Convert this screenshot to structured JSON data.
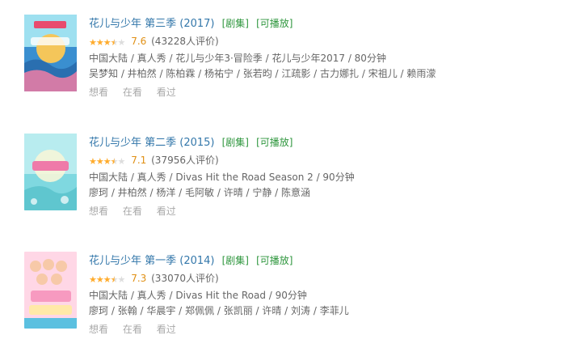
{
  "items": [
    {
      "title": "花儿与少年 第三季 (2017)",
      "tag_series": "[剧集]",
      "tag_play": "[可播放]",
      "rating": 3.8,
      "score": "7.6",
      "votes": "(43228人评价)",
      "meta_line1": "中国大陆 / 真人秀 / 花儿与少年3·冒险季 / 花儿与少年2017 / 80分钟",
      "meta_line2": "吴梦知 / 井柏然 / 陈柏霖 / 杨祐宁 / 张若昀 / 江疏影 / 古力娜扎 / 宋祖儿 / 赖雨濛",
      "actions": [
        "想看",
        "在看",
        "看过"
      ],
      "poster_colors": [
        "#3a8fd0",
        "#9ee0f0",
        "#f4c65a",
        "#f07ea6"
      ]
    },
    {
      "title": "花儿与少年 第二季 (2015)",
      "tag_series": "[剧集]",
      "tag_play": "[可播放]",
      "rating": 3.5,
      "score": "7.1",
      "votes": "(37956人评价)",
      "meta_line1": "中国大陆 / 真人秀 / Divas Hit the Road Season 2 / 90分钟",
      "meta_line2": "廖珂 / 井柏然 / 杨洋 / 毛阿敏 / 许晴 / 宁静 / 陈意涵",
      "actions": [
        "想看",
        "在看",
        "看过"
      ],
      "poster_colors": [
        "#7fd8e0",
        "#b8ecef",
        "#f6f6d8",
        "#ef7aa9"
      ]
    },
    {
      "title": "花儿与少年 第一季 (2014)",
      "tag_series": "[剧集]",
      "tag_play": "[可播放]",
      "rating": 3.5,
      "score": "7.3",
      "votes": "(33070人评价)",
      "meta_line1": "中国大陆 / 真人秀 / Divas Hit the Road / 90分钟",
      "meta_line2": "廖珂 / 张翰 / 华晨宇 / 郑佩佩 / 张凯丽 / 许晴 / 刘涛 / 李菲儿",
      "actions": [
        "想看",
        "在看",
        "看过"
      ],
      "poster_colors": [
        "#ffd7e6",
        "#f79ac0",
        "#ffe9a8",
        "#5bc0e0"
      ]
    }
  ]
}
